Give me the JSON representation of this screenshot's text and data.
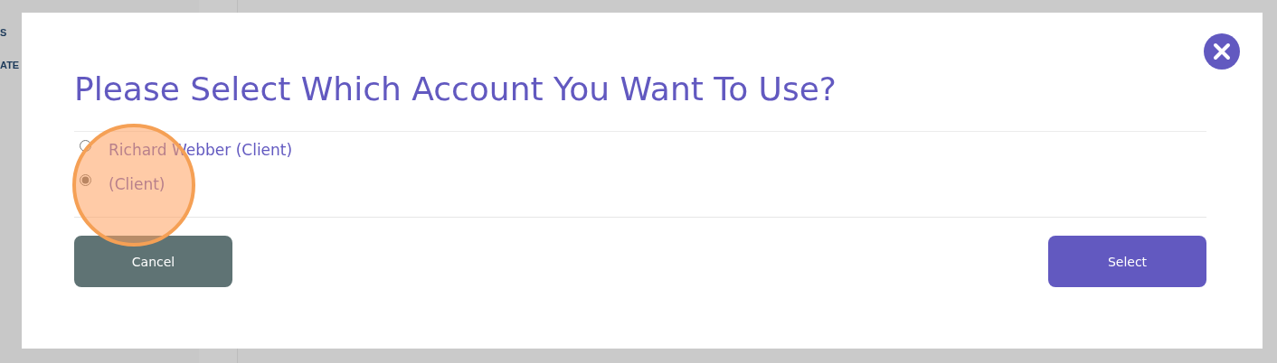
{
  "background": {
    "sidebar_items": [
      "S",
      "ATE"
    ]
  },
  "dialog": {
    "title": "Please Select Which Account You Want To Use?",
    "options": [
      {
        "label": "Richard Webber (Client)",
        "selected": false
      },
      {
        "label": "(Client)",
        "selected": true
      }
    ],
    "buttons": [
      {
        "label": "Cancel",
        "kind": "secondary"
      },
      {
        "label": "Select",
        "kind": "primary"
      }
    ]
  }
}
